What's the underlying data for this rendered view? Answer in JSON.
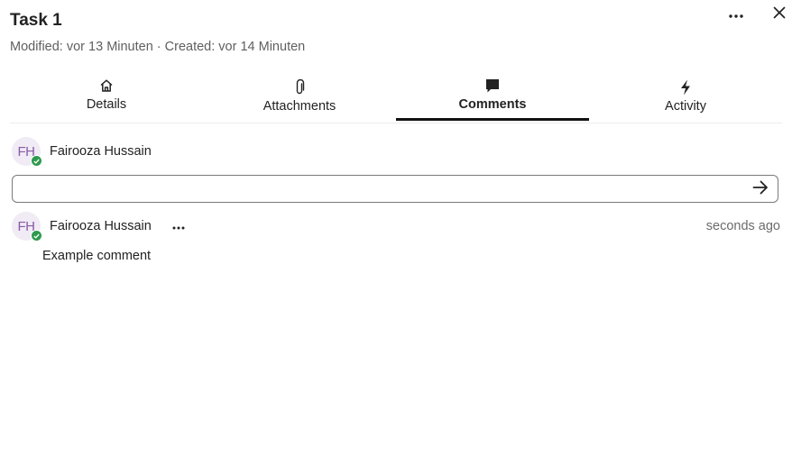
{
  "header": {
    "title": "Task 1",
    "subtitle": "Modified: vor 13 Minuten · Created: vor 14 Minuten",
    "more_icon": "more-horizontal-icon",
    "close_icon": "close-icon"
  },
  "tabs": [
    {
      "label": "Details",
      "icon": "home-icon",
      "active": false
    },
    {
      "label": "Attachments",
      "icon": "paperclip-icon",
      "active": false
    },
    {
      "label": "Comments",
      "icon": "comment-icon",
      "active": true
    },
    {
      "label": "Activity",
      "icon": "lightning-icon",
      "active": false
    }
  ],
  "composer": {
    "avatar_initials": "FH",
    "user_name": "Fairooza Hussain",
    "input_value": "",
    "input_placeholder": "",
    "send_icon": "arrow-right-icon"
  },
  "comments": [
    {
      "avatar_initials": "FH",
      "author": "Fairooza Hussain",
      "timestamp": "seconds ago",
      "text": "Example comment"
    }
  ],
  "colors": {
    "accent": "#111111",
    "status_online": "#2d9a4e",
    "avatar_bg": "#f0ebf4",
    "avatar_text": "#8a5ba8"
  }
}
